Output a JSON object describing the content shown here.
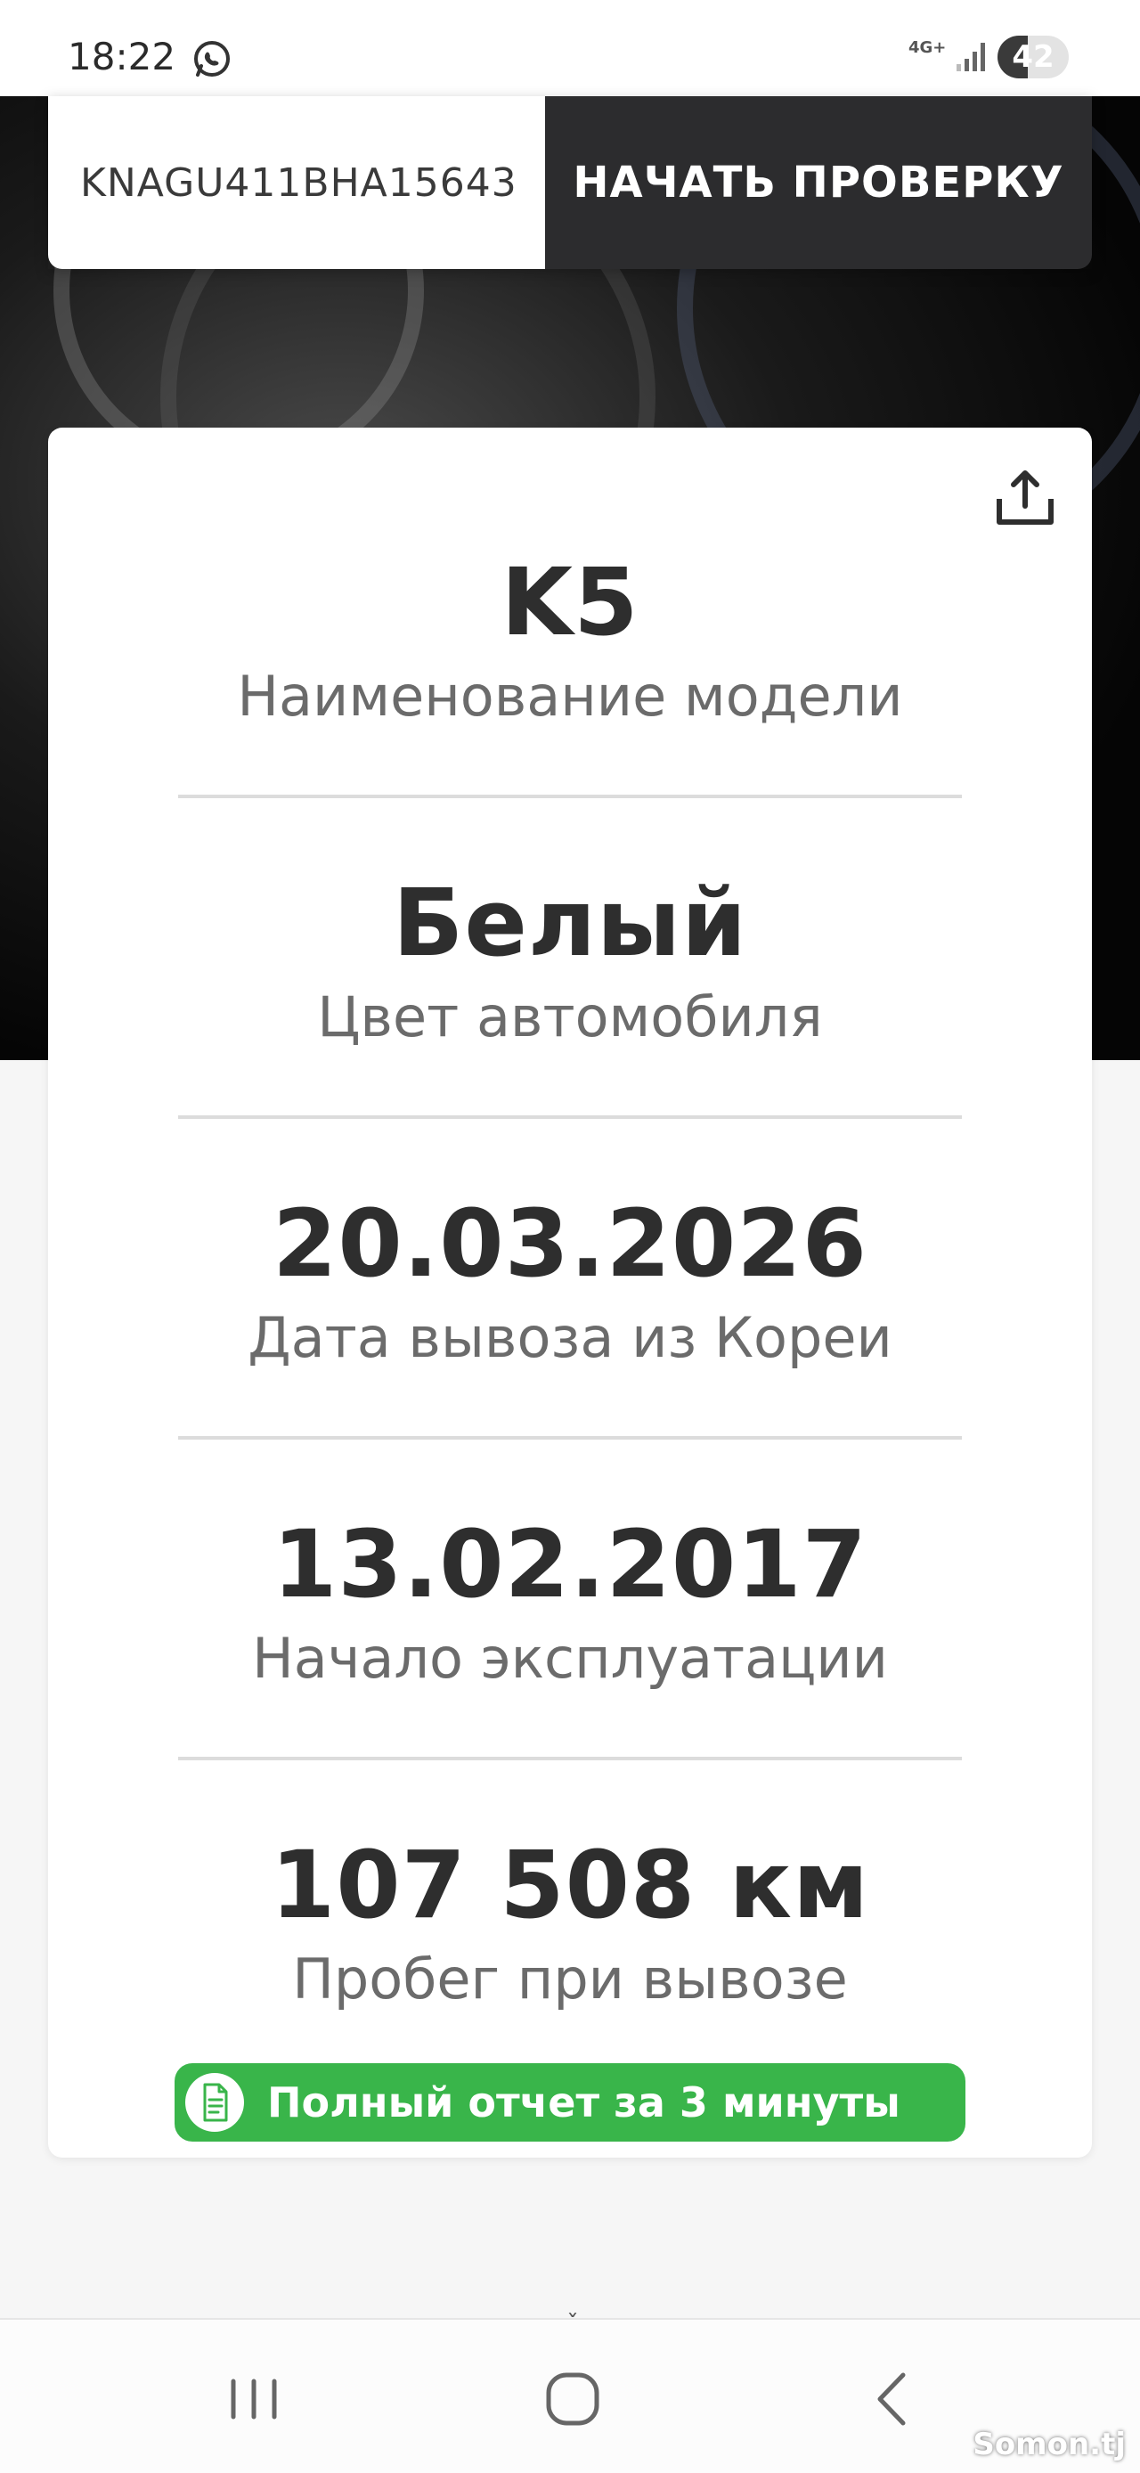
{
  "status_bar": {
    "time": "18:22",
    "network": "4G+",
    "battery": "42",
    "battery_level_percent": 42,
    "icons": [
      "whatsapp-icon",
      "signal-icon",
      "battery-icon"
    ]
  },
  "search": {
    "vin_value": "KNAGU411BHA15643",
    "start_button_label": "НАЧАТЬ ПРОВЕРКУ"
  },
  "card": {
    "share_icon": "share-icon",
    "items": [
      {
        "value": "K5",
        "label": "Наименование модели"
      },
      {
        "value": "Белый",
        "label": "Цвет автомобиля"
      },
      {
        "value": "20.03.2026",
        "label": "Дата вывоза из Кореи"
      },
      {
        "value": "13.02.2017",
        "label": "Начало эксплуатации"
      },
      {
        "value": "107 508 км",
        "label": "Пробег при вывозе"
      }
    ],
    "report_button_label": "Полный отчет за 3 минуты",
    "report_icon": "document-icon"
  },
  "nav": {
    "icons": [
      "recent-apps-icon",
      "home-icon",
      "back-icon"
    ]
  },
  "watermark": "Somon.tj",
  "colors": {
    "report_green": "#39b54a",
    "dark_button": "#2c2c2e",
    "text": "#2e2e2e",
    "muted": "#6b6b6b"
  }
}
